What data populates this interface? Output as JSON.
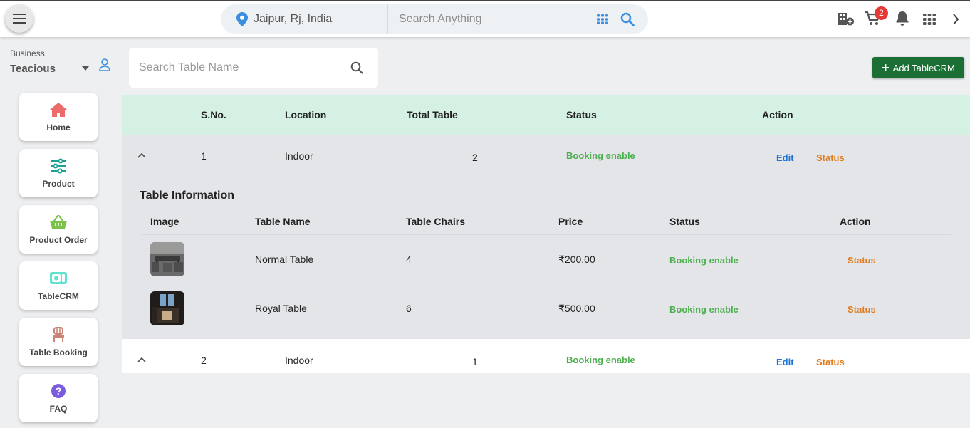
{
  "header": {
    "location": "Jaipur, Rj, India",
    "search_placeholder": "Search Anything",
    "cart_count": "2"
  },
  "sidebar": {
    "business_label": "Business",
    "business_name": "Teacious",
    "items": [
      {
        "label": "Home",
        "icon": "home-icon"
      },
      {
        "label": "Product",
        "icon": "sliders-icon"
      },
      {
        "label": "Product Order",
        "icon": "basket-icon"
      },
      {
        "label": "TableCRM",
        "icon": "tablecrm-icon"
      },
      {
        "label": "Table Booking",
        "icon": "chair-icon"
      },
      {
        "label": "FAQ",
        "icon": "help-icon"
      }
    ]
  },
  "main": {
    "search_placeholder": "Search Table Name",
    "add_button": "Add TableCRM",
    "columns": [
      "S.No.",
      "Location",
      "Total Table",
      "Status",
      "Action"
    ],
    "rows": [
      {
        "sno": "1",
        "location": "Indoor",
        "total": "2",
        "status": "Booking enable",
        "edit": "Edit",
        "status_action": "Status"
      },
      {
        "sno": "2",
        "location": "Indoor",
        "total": "1",
        "status": "Booking enable",
        "edit": "Edit",
        "status_action": "Status"
      }
    ],
    "table_info": {
      "title": "Table Information",
      "columns": [
        "Image",
        "Table Name",
        "Table Chairs",
        "Price",
        "Status",
        "Action"
      ],
      "rows": [
        {
          "name": "Normal Table",
          "chairs": "4",
          "price": "₹200.00",
          "status": "Booking enable",
          "action": "Status"
        },
        {
          "name": "Royal Table",
          "chairs": "6",
          "price": "₹500.00",
          "status": "Booking enable",
          "action": "Status"
        }
      ]
    }
  },
  "colors": {
    "accent_green": "#1b6f35",
    "header_mint": "#d4f1e4",
    "status_green": "#4caf50",
    "link_blue": "#1e74d3",
    "status_orange": "#e07c1c",
    "badge_red": "#e53935"
  }
}
